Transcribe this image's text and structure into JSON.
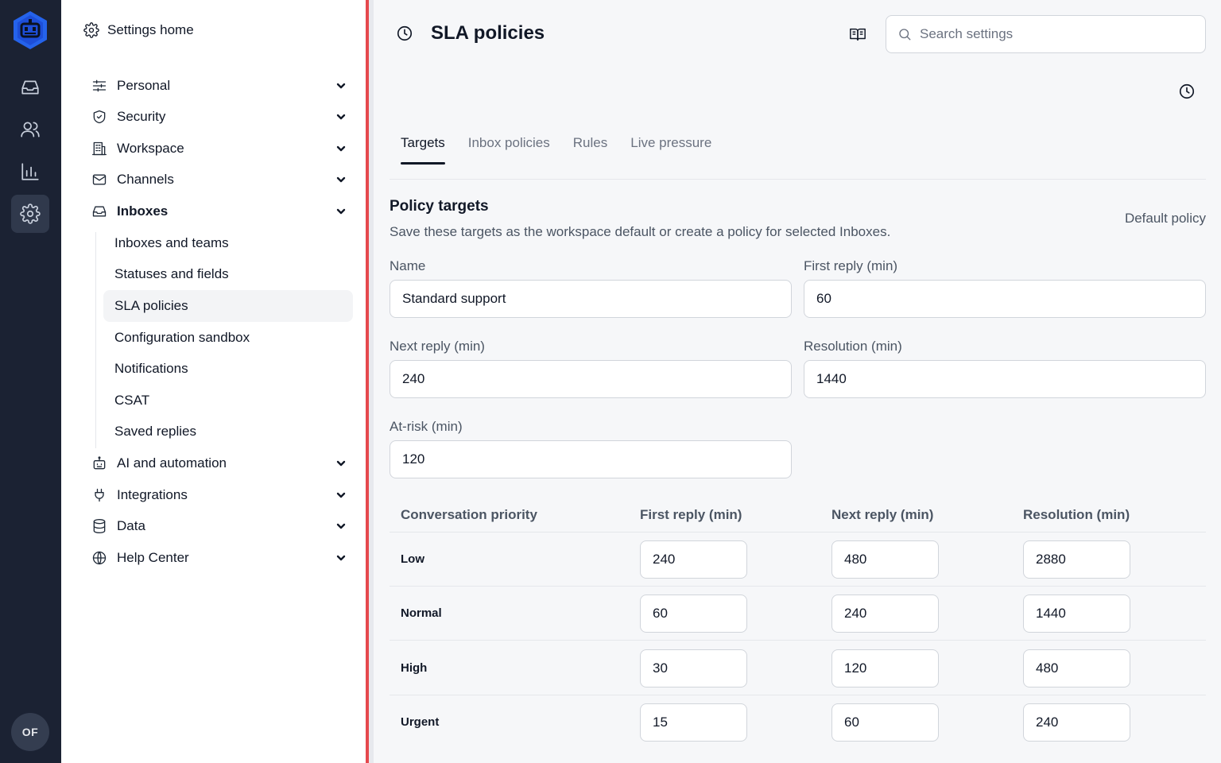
{
  "rail": {
    "avatar_initials": "OF",
    "items": [
      "inbox-icon",
      "users-icon",
      "chart-icon",
      "settings-icon"
    ],
    "accent": "#2563eb"
  },
  "sidebar": {
    "home_label": "Settings home",
    "groups": [
      {
        "label": "Personal",
        "icon": "sliders-icon"
      },
      {
        "label": "Security",
        "icon": "shield-icon"
      },
      {
        "label": "Workspace",
        "icon": "building-icon"
      },
      {
        "label": "Channels",
        "icon": "mail-icon"
      },
      {
        "label": "Inboxes",
        "icon": "inbox-icon"
      },
      {
        "label": "AI and automation",
        "icon": "robot-icon"
      },
      {
        "label": "Integrations",
        "icon": "plug-icon"
      },
      {
        "label": "Data",
        "icon": "database-icon"
      },
      {
        "label": "Help Center",
        "icon": "globe-icon"
      }
    ],
    "inbox_sub": [
      "Inboxes and teams",
      "Statuses and fields",
      "SLA policies",
      "Configuration sandbox",
      "Notifications",
      "CSAT",
      "Saved replies"
    ]
  },
  "header": {
    "title": "SLA policies",
    "search_placeholder": "Search settings"
  },
  "tabs": [
    "Targets",
    "Inbox policies",
    "Rules",
    "Live pressure"
  ],
  "section": {
    "title": "Policy targets",
    "description": "Save these targets as the workspace default or create a policy for selected Inboxes.",
    "right_label": "Default policy"
  },
  "form": {
    "name_label": "Name",
    "name_value": "Standard support",
    "first_reply_label": "First reply (min)",
    "first_reply_value": "60",
    "next_reply_label": "Next reply (min)",
    "next_reply_value": "240",
    "resolution_label": "Resolution (min)",
    "resolution_value": "1440",
    "at_risk_label": "At-risk (min)",
    "at_risk_value": "120"
  },
  "table": {
    "headers": [
      "Conversation priority",
      "First reply (min)",
      "Next reply (min)",
      "Resolution (min)"
    ],
    "rows": [
      {
        "priority": "Low",
        "first": "240",
        "next": "480",
        "resolution": "2880"
      },
      {
        "priority": "Normal",
        "first": "60",
        "next": "240",
        "resolution": "1440"
      },
      {
        "priority": "High",
        "first": "30",
        "next": "120",
        "resolution": "480"
      },
      {
        "priority": "Urgent",
        "first": "15",
        "next": "60",
        "resolution": "240"
      }
    ]
  }
}
